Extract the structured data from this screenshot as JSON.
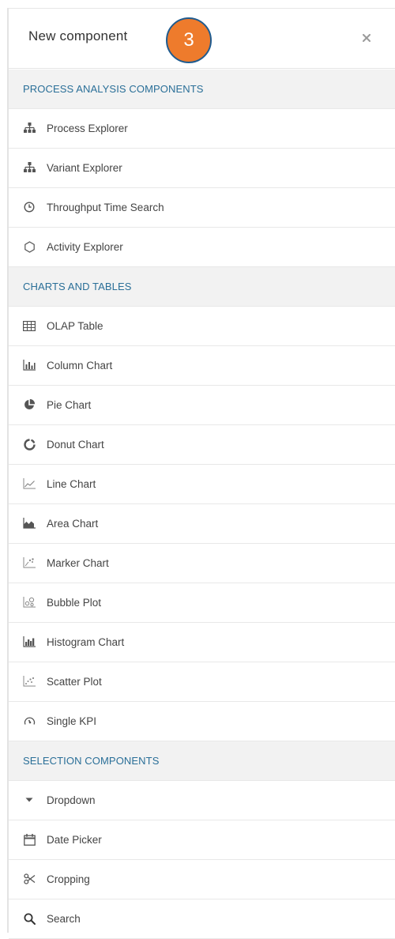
{
  "header": {
    "title": "New component",
    "step_badge": "3",
    "close_icon": "close-icon"
  },
  "sections": [
    {
      "label": "PROCESS ANALYSIS COMPONENTS",
      "items": [
        {
          "label": "Process Explorer",
          "icon": "hierarchy-icon"
        },
        {
          "label": "Variant Explorer",
          "icon": "hierarchy-icon"
        },
        {
          "label": "Throughput Time Search",
          "icon": "clock-icon"
        },
        {
          "label": "Activity Explorer",
          "icon": "hexagon-icon"
        }
      ]
    },
    {
      "label": "CHARTS AND TABLES",
      "items": [
        {
          "label": "OLAP Table",
          "icon": "table-icon"
        },
        {
          "label": "Column Chart",
          "icon": "column-chart-icon"
        },
        {
          "label": "Pie Chart",
          "icon": "pie-chart-icon"
        },
        {
          "label": "Donut Chart",
          "icon": "donut-chart-icon"
        },
        {
          "label": "Line Chart",
          "icon": "line-chart-icon"
        },
        {
          "label": "Area Chart",
          "icon": "area-chart-icon"
        },
        {
          "label": "Marker Chart",
          "icon": "marker-chart-icon"
        },
        {
          "label": "Bubble Plot",
          "icon": "bubble-plot-icon"
        },
        {
          "label": "Histogram Chart",
          "icon": "histogram-icon"
        },
        {
          "label": "Scatter Plot",
          "icon": "scatter-plot-icon"
        },
        {
          "label": "Single KPI",
          "icon": "gauge-icon"
        }
      ]
    },
    {
      "label": "SELECTION COMPONENTS",
      "items": [
        {
          "label": "Dropdown",
          "icon": "caret-down-icon"
        },
        {
          "label": "Date Picker",
          "icon": "calendar-icon"
        },
        {
          "label": "Cropping",
          "icon": "scissors-icon"
        },
        {
          "label": "Search",
          "icon": "search-icon"
        }
      ]
    }
  ],
  "colors": {
    "section_text": "#2a6f98",
    "section_bg": "#f2f2f2",
    "badge": "#ee7b2c",
    "badge_border": "#1f5b8f",
    "item_text": "#444444",
    "icon": "#555555"
  }
}
